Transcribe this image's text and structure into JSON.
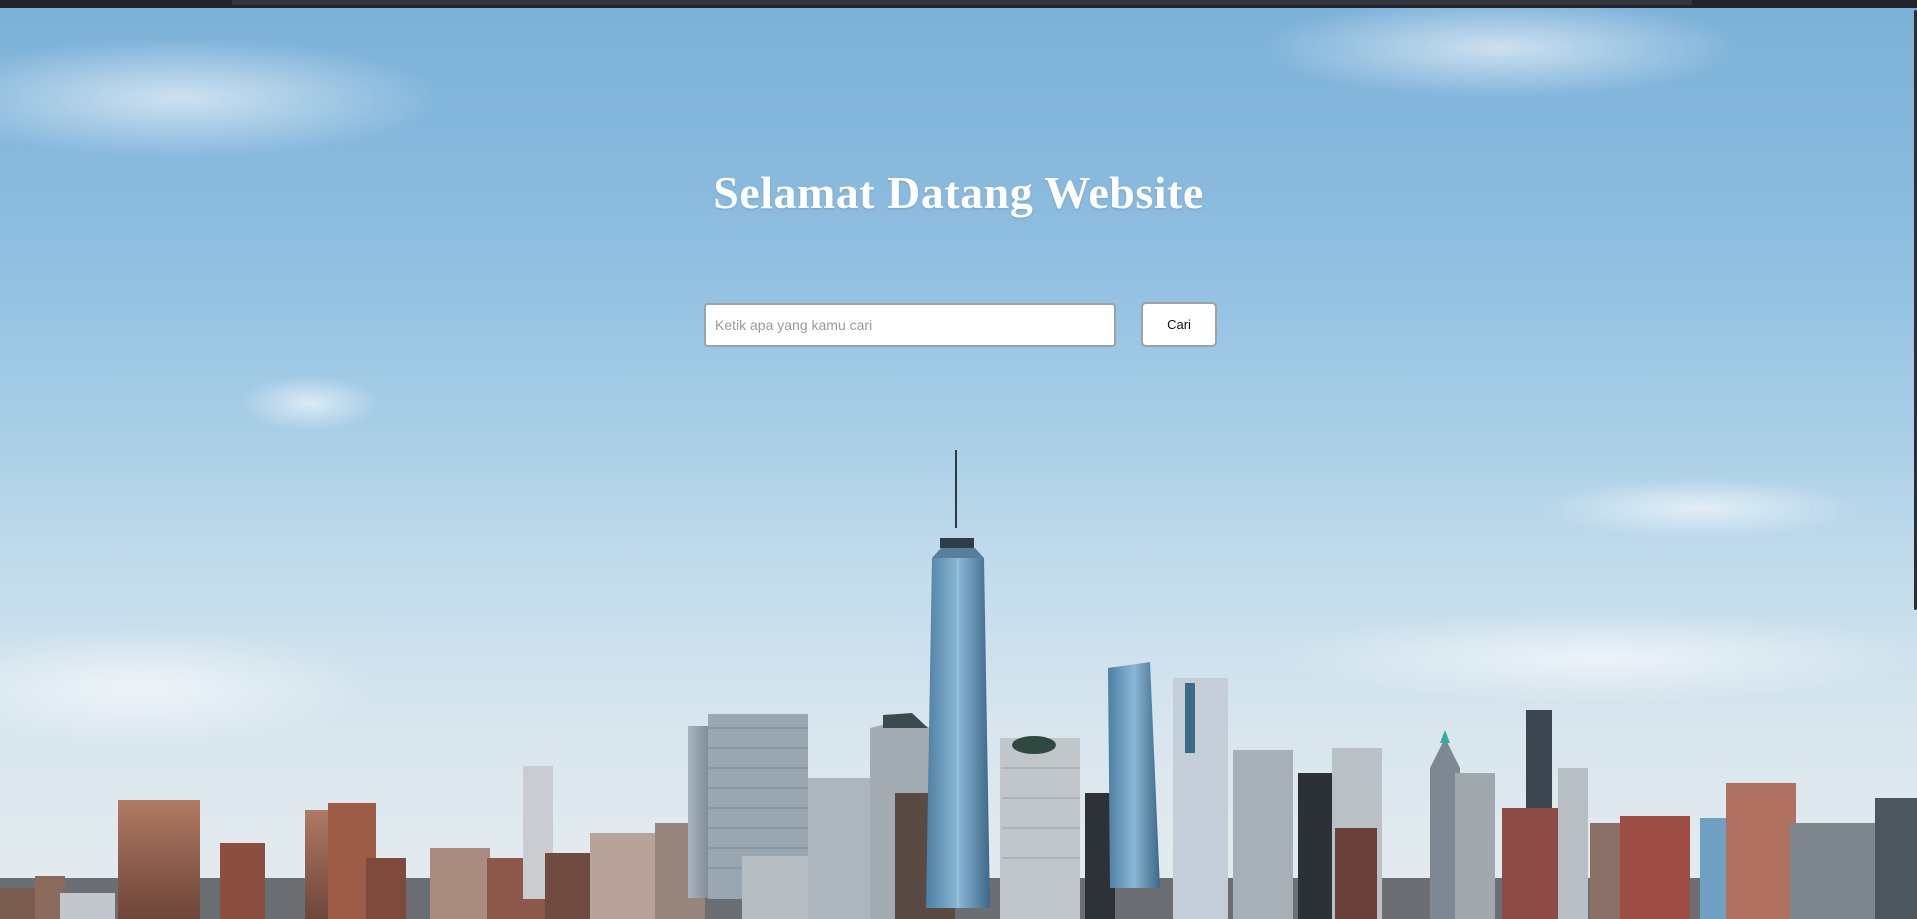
{
  "hero": {
    "title": "Selamat Datang Website",
    "background": "city-skyline-photo"
  },
  "search": {
    "placeholder": "Ketik apa yang kamu cari",
    "value": "",
    "button_label": "Cari"
  },
  "colors": {
    "sky_top": "#7cb1d8",
    "sky_bottom": "#e6ecef",
    "title_text": "#ffffff",
    "window_chrome": "#1e1f24"
  }
}
